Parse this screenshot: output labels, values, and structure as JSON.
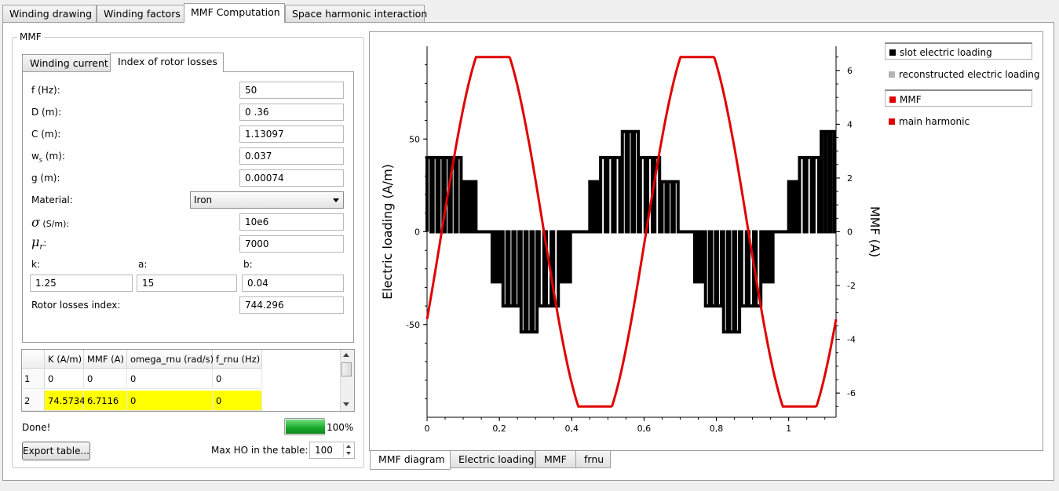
{
  "top_tabs": [
    "Winding drawing",
    "Winding factors",
    "MMF Computation",
    "Space harmonic interaction"
  ],
  "mmf_group_title": "MMF",
  "inner_tabs": [
    "Winding current",
    "Index of rotor losses"
  ],
  "params": {
    "f_label": "f (Hz):",
    "f_value": "50",
    "D_label": "D (m):",
    "D_value": "0 .36",
    "C_label": "C (m):",
    "C_value": "1.13097",
    "ws_label_w": "w",
    "ws_label_sub": "s",
    "ws_label_rest": " (m):",
    "ws_value": "0.037",
    "g_label": "g (m):",
    "g_value": "0.00074",
    "material_label": "Material:",
    "material_value": "Iron",
    "sigma_symbol": "σ",
    "sigma_label": " (S/m):",
    "sigma_value": "10e6",
    "mu_symbol": "μ",
    "mu_sub": "r",
    "mu_colon": ":",
    "mu_value": "7000",
    "k_label": "k:",
    "k_value": "1.25",
    "a_label": "a:",
    "a_value": "15",
    "b_label": "b:",
    "b_value": "0.04",
    "rotor_label": "Rotor losses index:",
    "rotor_value": "744.296"
  },
  "table": {
    "columns": [
      "K (A/m)",
      "MMF (A)",
      "omega_rnu (rad/s)",
      "f_rnu (Hz)"
    ],
    "rows": [
      {
        "index": "1",
        "cells": [
          "0",
          "0",
          "0",
          "0"
        ],
        "highlight": false
      },
      {
        "index": "2",
        "cells": [
          "74.5734",
          "6.7116",
          "0",
          "0"
        ],
        "highlight": true
      }
    ]
  },
  "status_text": "Done!",
  "progress": {
    "value": 100,
    "label": "100%",
    "color": "#22bb33"
  },
  "export_button": "Export table...",
  "max_ho_label": "Max HO in the table:",
  "max_ho_value": "100",
  "bottom_tabs": [
    "MMF diagram",
    "Electric loading",
    "MMF",
    "frnu"
  ],
  "legend": [
    {
      "label": "slot electric loading",
      "color": "#000000"
    },
    {
      "label": "reconstructed electric loading",
      "color": "#b4b4b4"
    },
    {
      "label": "MMF",
      "color": "#e00000"
    },
    {
      "label": "main harmonic",
      "color": "#e00000"
    }
  ],
  "chart_data": {
    "type": "line",
    "ylabel": "Electric loading (A/m)",
    "y2label": "MMF (A)",
    "x_ticks": [
      "0",
      "0,2",
      "0,4",
      "0,6",
      "0,8",
      "1"
    ],
    "y_ticks": [
      "-50",
      "0",
      "50"
    ],
    "y2_ticks": [
      "-6",
      "-4",
      "-2",
      "0",
      "2",
      "4",
      "6"
    ],
    "xlim": [
      0,
      1.13097
    ],
    "ylim": [
      -100,
      100
    ],
    "y2lim": [
      -6.9,
      6.9
    ],
    "grid": false,
    "legend_position": "right",
    "series": [
      {
        "name": "slot electric loading",
        "color": "#000000",
        "step_amplitudes": [
          40,
          40,
          27,
          0,
          -27,
          -40,
          -54,
          -40,
          -27,
          0,
          27,
          40,
          54,
          40,
          27,
          0,
          -27,
          -40,
          -54,
          -40,
          -27,
          0,
          27,
          40,
          54
        ],
        "step_x": [
          0,
          0.05,
          0.1,
          0.14,
          0.18,
          0.21,
          0.26,
          0.31,
          0.37,
          0.4,
          0.45,
          0.48,
          0.54,
          0.59,
          0.65,
          0.7,
          0.74,
          0.77,
          0.82,
          0.87,
          0.93,
          0.96,
          1.0,
          1.03,
          1.09
        ]
      },
      {
        "name": "MMF",
        "color": "#e00000",
        "amplitude": 6.5,
        "period": 0.5655,
        "phase_x": 0.0
      }
    ]
  }
}
